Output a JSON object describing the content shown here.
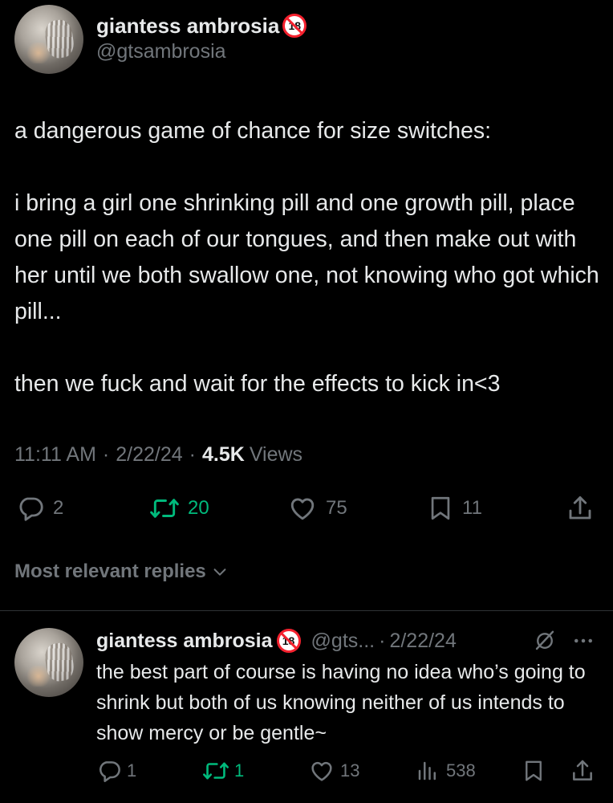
{
  "post": {
    "author_name": "giantess ambrosia",
    "author_badge": "18",
    "author_handle": "@gtsambrosia",
    "text": "a dangerous game of chance for size switches:\n\ni bring a girl one shrinking pill and one growth pill, place one pill on each of our tongues, and then make out with her until we both swallow one, not knowing who got which pill...\n\nthen we fuck and wait for the effects to kick in<3",
    "time": "11:11 AM",
    "sep1": "·",
    "date": "2/22/24",
    "sep2": "·",
    "views_count": "4.5K",
    "views_label": "Views",
    "actions": {
      "replies": "2",
      "reposts": "20",
      "likes": "75",
      "bookmarks": "11"
    }
  },
  "replies_filter": {
    "label": "Most relevant replies"
  },
  "reply": {
    "author_name": "giantess ambrosia",
    "author_badge": "18",
    "author_handle": "@gts...",
    "sep": "·",
    "date": "2/22/24",
    "text": "the best part of course is having no idea who’s going to shrink but both of us knowing neither of us intends to show mercy or be gentle~",
    "actions": {
      "replies": "1",
      "reposts": "1",
      "likes": "13",
      "views": "538"
    }
  },
  "colors": {
    "background": "#000000",
    "text": "#e7e9ea",
    "muted": "#71767b",
    "repost_green": "#00ba7c",
    "badge_red": "#f4212e",
    "divider": "#2f3336"
  },
  "icons": [
    "reply-icon",
    "repost-icon",
    "like-icon",
    "bookmark-icon",
    "share-icon",
    "views-icon",
    "chevron-down-icon",
    "grok-icon",
    "more-icon"
  ]
}
